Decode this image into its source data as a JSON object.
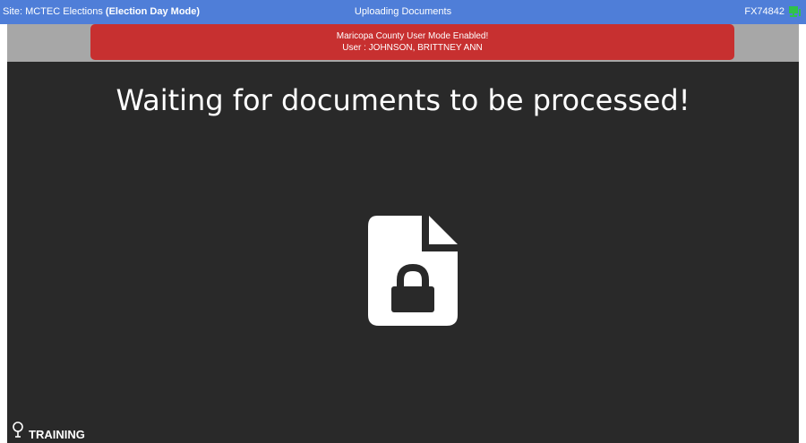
{
  "topbar": {
    "site_prefix": "Site: MCTEC Elections ",
    "site_mode": "(Election Day Mode)",
    "center_title": "Uploading Documents",
    "device_id": "FX74842",
    "status_icon": "network-connected-icon",
    "bar_color": "#4f7ed8"
  },
  "alert": {
    "line1": "Maricopa County User Mode Enabled!",
    "line2": "User : JOHNSON, BRITTNEY ANN",
    "color": "#c73030"
  },
  "main": {
    "message": "Waiting for documents to be processed!",
    "icon": "locked-document-icon",
    "background": "#292929"
  },
  "footer": {
    "mode_label": "TRAINING",
    "mode_icon": "lightbulb-icon"
  }
}
